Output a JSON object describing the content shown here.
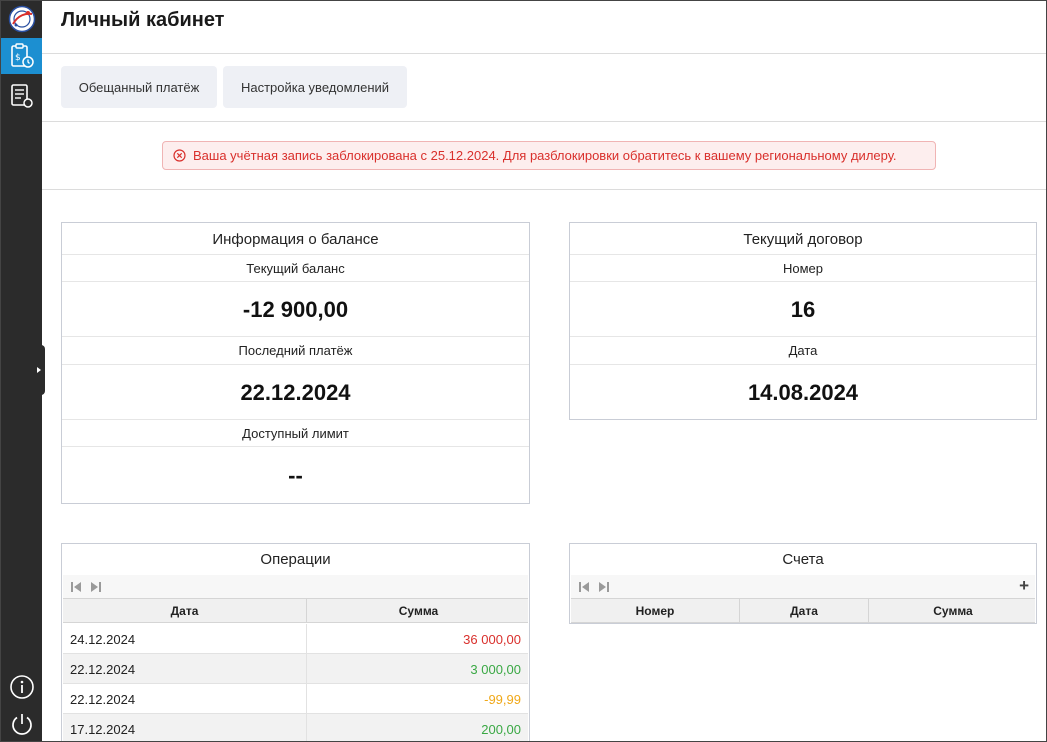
{
  "sidebar": {
    "icons": [
      "logo-icon",
      "clipboard-dollar-icon",
      "document-list-icon",
      "info-icon",
      "power-icon"
    ]
  },
  "header": {
    "title": "Личный кабинет"
  },
  "actions": {
    "promised_payment": "Обещанный платёж",
    "notification_settings": "Настройка уведомлений"
  },
  "alert": {
    "text": "Ваша учётная запись заблокирована с 25.12.2024. Для разблокировки обратитесь к вашему региональному дилеру.",
    "color": "#d9302c"
  },
  "balance": {
    "title": "Информация о балансе",
    "current_label": "Текущий баланс",
    "current_value": "-12 900,00",
    "last_payment_label": "Последний платёж",
    "last_payment_value": "22.12.2024",
    "limit_label": "Доступный лимит",
    "limit_value": "--"
  },
  "contract": {
    "title": "Текущий договор",
    "number_label": "Номер",
    "number_value": "16",
    "date_label": "Дата",
    "date_value": "14.08.2024"
  },
  "operations": {
    "title": "Операции",
    "columns": [
      "Дата",
      "Сумма"
    ],
    "rows": [
      {
        "date": "24.12.2024",
        "sum": "36 000,00",
        "color": "#d9302c"
      },
      {
        "date": "22.12.2024",
        "sum": "3 000,00",
        "color": "#3aa844"
      },
      {
        "date": "22.12.2024",
        "sum": "-99,99",
        "color": "#f0a818"
      },
      {
        "date": "17.12.2024",
        "sum": "200,00",
        "color": "#3aa844"
      }
    ]
  },
  "invoices": {
    "title": "Счета",
    "columns": [
      "Номер",
      "Дата",
      "Сумма"
    ],
    "add_label": "+"
  }
}
